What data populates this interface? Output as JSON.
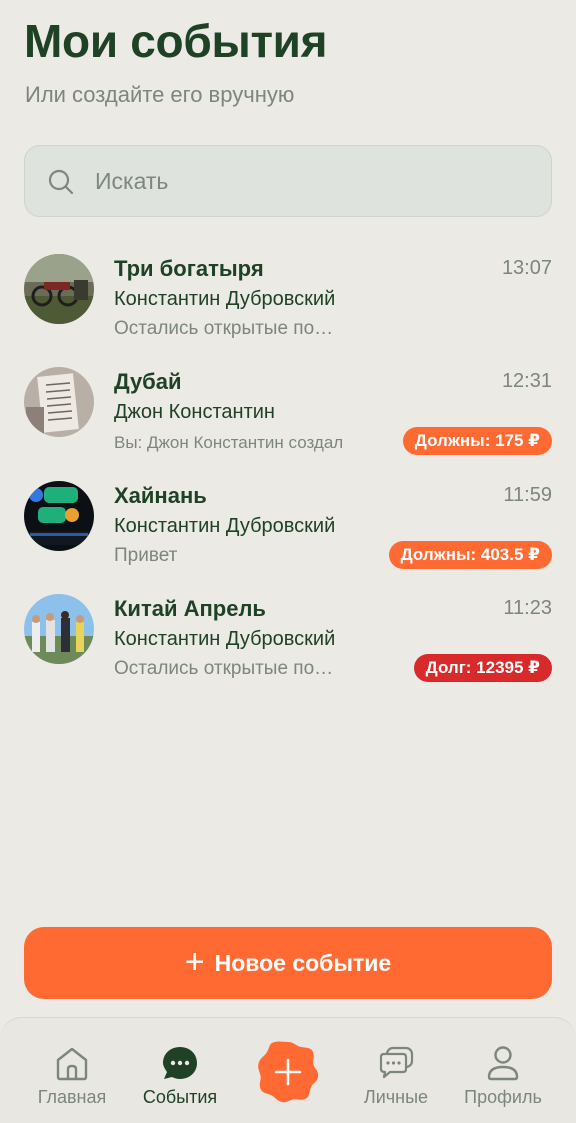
{
  "header": {
    "title": "Мои события",
    "subtitle": "Или создайте его вручную"
  },
  "search": {
    "placeholder": "Искать",
    "icon": "search-icon"
  },
  "events": [
    {
      "title": "Три богатыря",
      "time": "13:07",
      "author": "Константин Дубровский",
      "preview": "Остались открытые по…",
      "badge": ""
    },
    {
      "title": "Дубай",
      "time": "12:31",
      "author": "Джон Константин",
      "preview": "Вы: Джон Константин создал",
      "badge": "Должны: 175 ₽",
      "badge_color": "#FF6A33"
    },
    {
      "title": "Хайнань",
      "time": "11:59",
      "author": "Константин Дубровский",
      "preview": "Привет",
      "badge": "Должны: 403.5 ₽",
      "badge_color": "#FF6A33"
    },
    {
      "title": "Китай Апрель",
      "time": "11:23",
      "author": "Константин Дубровский",
      "preview": "Остались открытые по…",
      "badge": "Долг: 12395 ₽",
      "badge_color": "#D82A2A"
    }
  ],
  "new_event_button": {
    "label": "Новое событие"
  },
  "tabbar": {
    "home": "Главная",
    "events": "События",
    "personal": "Личные",
    "profile": "Профиль"
  },
  "colors": {
    "accent": "#FF6A33",
    "debt": "#D82A2A",
    "primary_text": "#1F4126",
    "muted_text": "#7C857E",
    "background": "#ECEAE5"
  }
}
